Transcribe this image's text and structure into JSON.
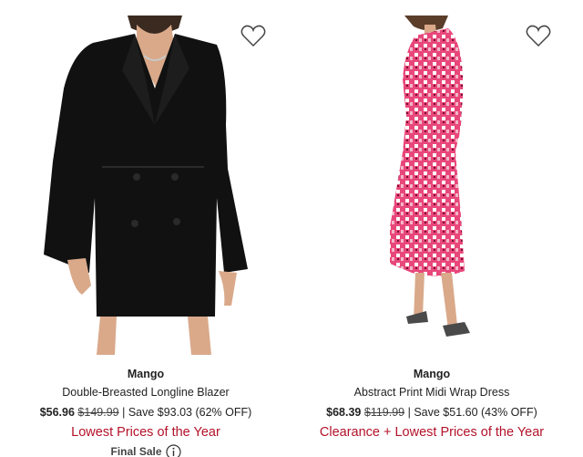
{
  "products": [
    {
      "brand": "Mango",
      "name": "Double-Breasted Longline Blazer",
      "sale_price": "$56.96",
      "original_price": "$149.99",
      "save_text": "| Save $93.03 (62% OFF)",
      "promo": "Lowest Prices of the Year",
      "final_sale": "Final Sale",
      "image_icon": "black-blazer-dress-image",
      "favorite_icon": "heart-outline-icon"
    },
    {
      "brand": "Mango",
      "name": "Abstract Print Midi Wrap Dress",
      "sale_price": "$68.39",
      "original_price": "$119.99",
      "save_text": "| Save $51.60 (43% OFF)",
      "promo": "Clearance + Lowest Prices of the Year",
      "image_icon": "pink-print-wrap-dress-image",
      "favorite_icon": "heart-outline-icon"
    }
  ],
  "colors": {
    "promo_red": "#b3122a",
    "text": "#222222"
  }
}
